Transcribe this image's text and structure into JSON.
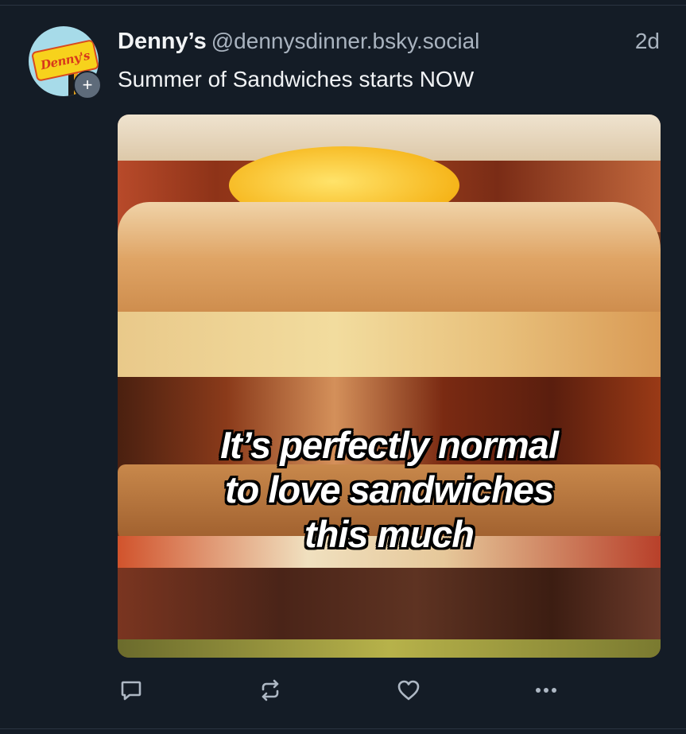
{
  "post": {
    "avatar_logo_text": "Denny's",
    "display_name": "Denny’s",
    "handle": "@dennysdinner.bsky.social",
    "timestamp": "2d",
    "text": "Summer of Sandwiches starts NOW"
  },
  "media": {
    "overlay_lines": [
      "It’s perfectly normal",
      "to love sandwiches",
      "this much"
    ]
  },
  "actions": {
    "reply_icon": "reply-icon",
    "repost_icon": "repost-icon",
    "like_icon": "heart-icon",
    "more_icon": "more-icon"
  },
  "colors": {
    "background": "#141c26",
    "primary_text": "#f1f3f5",
    "secondary_text": "#a9b3bf",
    "icon": "#aeb8c4"
  }
}
